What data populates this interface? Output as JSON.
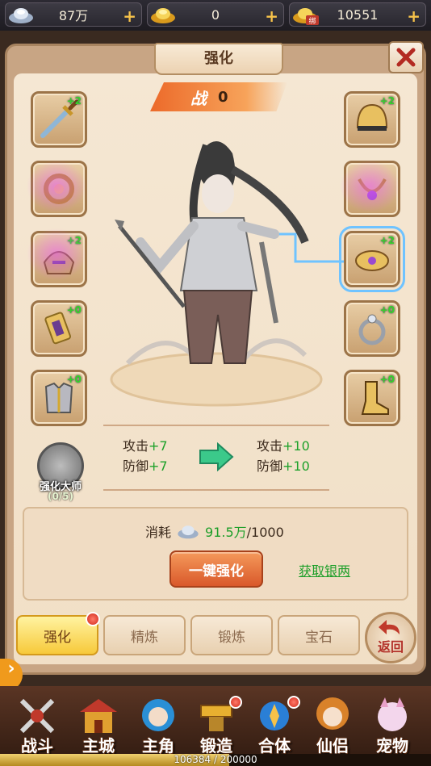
{
  "currency": [
    {
      "icon": "silver-ingot-icon",
      "value": "87万"
    },
    {
      "icon": "gold-ingot-icon",
      "value": "0"
    },
    {
      "icon": "bound-gold-ingot-icon",
      "value": "10551",
      "badge": "绑"
    }
  ],
  "panel": {
    "title": "强化",
    "power_label": "战",
    "power_value": "0"
  },
  "slots_left": [
    {
      "name": "sword",
      "level": "+2"
    },
    {
      "name": "ring-charm",
      "level": ""
    },
    {
      "name": "shoulder-armor",
      "level": "+2"
    },
    {
      "name": "belt-buckle",
      "level": "+0"
    },
    {
      "name": "chest-armor",
      "level": "+0"
    }
  ],
  "slots_right": [
    {
      "name": "helmet",
      "level": "+2"
    },
    {
      "name": "necklace",
      "level": ""
    },
    {
      "name": "bracer",
      "level": "+2"
    },
    {
      "name": "ring",
      "level": "+0"
    },
    {
      "name": "boots",
      "level": "+0"
    }
  ],
  "stats": {
    "current": [
      {
        "label": "攻击",
        "value": "+7"
      },
      {
        "label": "防御",
        "value": "+7"
      }
    ],
    "next": [
      {
        "label": "攻击",
        "value": "+10"
      },
      {
        "label": "防御",
        "value": "+10"
      }
    ]
  },
  "master": {
    "name": "强化大师",
    "count": "(0/5)"
  },
  "cost": {
    "label": "消耗",
    "amount": "91.5万",
    "required": "/1000"
  },
  "actions": {
    "one_click": "一键强化",
    "get_silver": "获取银两"
  },
  "subtabs": [
    {
      "label": "强化",
      "active": true,
      "dot": true
    },
    {
      "label": "精炼",
      "active": false,
      "dot": false
    },
    {
      "label": "锻炼",
      "active": false,
      "dot": false
    },
    {
      "label": "宝石",
      "active": false,
      "dot": false
    }
  ],
  "back_label": "返回",
  "nav": [
    {
      "label": "战斗",
      "icon": "crossed-swords-icon",
      "color": "#c0392b",
      "dot": false
    },
    {
      "label": "主城",
      "icon": "palace-icon",
      "color": "#c0392b",
      "dot": false
    },
    {
      "label": "主角",
      "icon": "hero-portrait-icon",
      "color": "#2a8fd6",
      "dot": false
    },
    {
      "label": "锻造",
      "icon": "anvil-icon",
      "color": "#d99a1c",
      "dot": true
    },
    {
      "label": "合体",
      "icon": "fusion-icon",
      "color": "#2a7fd6",
      "dot": true
    },
    {
      "label": "仙侣",
      "icon": "fairy-portrait-icon",
      "color": "#d9822a",
      "dot": false
    },
    {
      "label": "宠物",
      "icon": "pet-icon",
      "color": "#e8a0c8",
      "dot": false
    }
  ],
  "exp": {
    "text": "106384 / 200000",
    "fraction": 0.532
  }
}
